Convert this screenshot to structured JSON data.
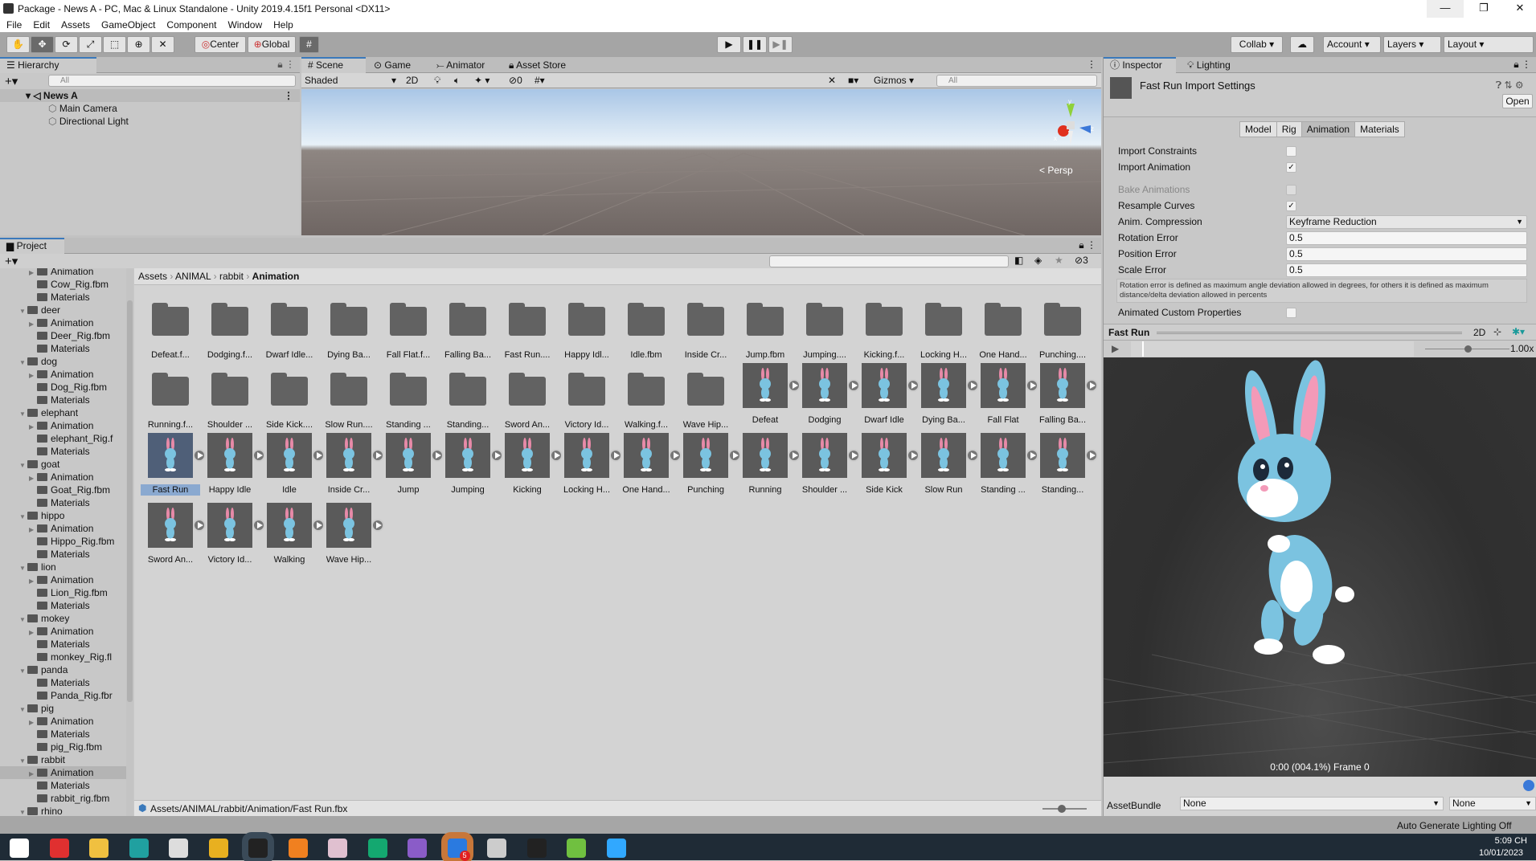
{
  "window": {
    "title": "Package - News A - PC, Mac & Linux Standalone - Unity 2019.4.15f1 Personal <DX11>",
    "minimize": "—",
    "restore": "❐",
    "close": "✕"
  },
  "menu": [
    "File",
    "Edit",
    "Assets",
    "GameObject",
    "Component",
    "Window",
    "Help"
  ],
  "toolbar": {
    "tools": [
      "hand-tool",
      "move-tool",
      "rotate-tool",
      "scale-tool",
      "rect-tool",
      "transform-tool",
      "custom-tool"
    ],
    "center": "Center",
    "global": "Global",
    "collab": "Collab ▾",
    "account": "Account",
    "layers": "Layers",
    "layout": "Layout"
  },
  "hierarchy": {
    "tab": "Hierarchy",
    "search_placeholder": "All",
    "scene": "News A",
    "items": [
      "Main Camera",
      "Directional Light"
    ]
  },
  "scene": {
    "tabs": [
      "Scene",
      "Game",
      "Animator",
      "Asset Store"
    ],
    "shading": "Shaded",
    "mode2d": "2D",
    "hidden_count": "0",
    "gizmos": "Gizmos",
    "search_placeholder": "All",
    "persp": "< Persp",
    "axis_x": "x",
    "axis_y": "y",
    "axis_z": "z"
  },
  "project": {
    "tab": "Project",
    "search_placeholder": "",
    "hidden_count": "3",
    "breadcrumb": [
      "Assets",
      "ANIMAL",
      "rabbit",
      "Animation"
    ],
    "tree": [
      {
        "l": 2,
        "a": 1,
        "t": "Animation"
      },
      {
        "l": 2,
        "t": "Cow_Rig.fbm"
      },
      {
        "l": 2,
        "t": "Materials"
      },
      {
        "l": 1,
        "e": 1,
        "t": "deer"
      },
      {
        "l": 2,
        "a": 1,
        "t": "Animation"
      },
      {
        "l": 2,
        "t": "Deer_Rig.fbm"
      },
      {
        "l": 2,
        "t": "Materials"
      },
      {
        "l": 1,
        "e": 1,
        "t": "dog"
      },
      {
        "l": 2,
        "a": 1,
        "t": "Animation"
      },
      {
        "l": 2,
        "t": "Dog_Rig.fbm"
      },
      {
        "l": 2,
        "t": "Materials"
      },
      {
        "l": 1,
        "e": 1,
        "t": "elephant"
      },
      {
        "l": 2,
        "a": 1,
        "t": "Animation"
      },
      {
        "l": 2,
        "t": "elephant_Rig.f"
      },
      {
        "l": 2,
        "t": "Materials"
      },
      {
        "l": 1,
        "e": 1,
        "t": "goat"
      },
      {
        "l": 2,
        "a": 1,
        "t": "Animation"
      },
      {
        "l": 2,
        "t": "Goat_Rig.fbm"
      },
      {
        "l": 2,
        "t": "Materials"
      },
      {
        "l": 1,
        "e": 1,
        "t": "hippo"
      },
      {
        "l": 2,
        "a": 1,
        "t": "Animation"
      },
      {
        "l": 2,
        "t": "Hippo_Rig.fbm"
      },
      {
        "l": 2,
        "t": "Materials"
      },
      {
        "l": 1,
        "e": 1,
        "t": "lion"
      },
      {
        "l": 2,
        "a": 1,
        "t": "Animation"
      },
      {
        "l": 2,
        "t": "Lion_Rig.fbm"
      },
      {
        "l": 2,
        "t": "Materials"
      },
      {
        "l": 1,
        "e": 1,
        "t": "mokey"
      },
      {
        "l": 2,
        "a": 1,
        "t": "Animation"
      },
      {
        "l": 2,
        "t": "Materials"
      },
      {
        "l": 2,
        "t": "monkey_Rig.fl"
      },
      {
        "l": 1,
        "e": 1,
        "t": "panda"
      },
      {
        "l": 2,
        "t": "Materials"
      },
      {
        "l": 2,
        "t": "Panda_Rig.fbr"
      },
      {
        "l": 1,
        "e": 1,
        "t": "pig"
      },
      {
        "l": 2,
        "a": 1,
        "t": "Animation"
      },
      {
        "l": 2,
        "t": "Materials"
      },
      {
        "l": 2,
        "t": "pig_Rig.fbm"
      },
      {
        "l": 1,
        "e": 1,
        "t": "rabbit"
      },
      {
        "l": 2,
        "a": 1,
        "s": 1,
        "t": "Animation"
      },
      {
        "l": 2,
        "t": "Materials"
      },
      {
        "l": 2,
        "t": "rabbit_rig.fbm"
      },
      {
        "l": 1,
        "e": 1,
        "t": "rhino"
      }
    ],
    "folders": [
      "Defeat.f...",
      "Dodging.f...",
      "Dwarf Idle...",
      "Dying Ba...",
      "Fall Flat.f...",
      "Falling Ba...",
      "Fast Run....",
      "Happy Idl...",
      "Idle.fbm",
      "Inside Cr...",
      "Jump.fbm",
      "Jumping....",
      "Kicking.f...",
      "Locking H...",
      "One Hand...",
      "Punching....",
      "Running.f...",
      "Shoulder ...",
      "Side Kick....",
      "Slow Run....",
      "Standing ...",
      "Standing...",
      "Sword An...",
      "Victory Id...",
      "Walking.f...",
      "Wave Hip..."
    ],
    "animations": [
      "Defeat",
      "Dodging",
      "Dwarf Idle",
      "Dying Ba...",
      "Fall Flat",
      "Falling Ba...",
      "Fast Run",
      "Happy Idle",
      "Idle",
      "Inside Cr...",
      "Jump",
      "Jumping",
      "Kicking",
      "Locking H...",
      "One Hand...",
      "Punching",
      "Running",
      "Shoulder ...",
      "Side Kick",
      "Slow Run",
      "Standing ...",
      "Standing...",
      "Sword An...",
      "Victory Id...",
      "Walking",
      "Wave Hip..."
    ],
    "selected": "Fast Run",
    "footer_path": "Assets/ANIMAL/rabbit/Animation/Fast Run.fbx",
    "icon_size_slider": 0.35
  },
  "inspector": {
    "tabs": [
      "Inspector",
      "Lighting"
    ],
    "asset_title": "Fast Run Import Settings",
    "open": "Open",
    "subtabs": [
      "Model",
      "Rig",
      "Animation",
      "Materials"
    ],
    "active_subtab": "Animation",
    "import_constraints": {
      "label": "Import Constraints",
      "checked": false
    },
    "import_animation": {
      "label": "Import Animation",
      "checked": true
    },
    "bake_animations": {
      "label": "Bake Animations",
      "checked": false
    },
    "resample_curves": {
      "label": "Resample Curves",
      "checked": true
    },
    "anim_compression": {
      "label": "Anim. Compression",
      "value": "Keyframe Reduction"
    },
    "rotation_error": {
      "label": "Rotation Error",
      "value": "0.5"
    },
    "position_error": {
      "label": "Position Error",
      "value": "0.5"
    },
    "scale_error": {
      "label": "Scale Error",
      "value": "0.5"
    },
    "help": "Rotation error is defined as maximum angle deviation allowed in degrees, for others it is defined as maximum distance/delta deviation allowed in percents",
    "animated_custom": {
      "label": "Animated Custom Properties",
      "checked": false
    },
    "preview": {
      "title": "Fast Run",
      "mode2d": "2D",
      "speed": "1.00x",
      "speed_fraction": 0.5,
      "progress_percent": 4.1,
      "status": "0:00 (004.1%) Frame 0"
    },
    "assetbundle": {
      "label": "AssetBundle",
      "value": "None",
      "variant": "None"
    }
  },
  "status": {
    "lighting": "Auto Generate Lighting Off"
  },
  "taskbar": {
    "icons": [
      {
        "n": "windows-start",
        "c": "#ffffff"
      },
      {
        "n": "app-red",
        "c": "#e03030"
      },
      {
        "n": "file-explorer",
        "c": "#f0c040"
      },
      {
        "n": "maya",
        "c": "#20a0a0"
      },
      {
        "n": "zbrush",
        "c": "#dddddd"
      },
      {
        "n": "chrome",
        "c": "#e8b020"
      },
      {
        "n": "unity",
        "c": "#222222"
      },
      {
        "n": "blender",
        "c": "#f08020"
      },
      {
        "n": "app-brain",
        "c": "#e0c0d0"
      },
      {
        "n": "upwork",
        "c": "#14a870"
      },
      {
        "n": "github-desktop",
        "c": "#8a5cc8"
      },
      {
        "n": "zalo",
        "c": "#2a7ae0"
      },
      {
        "n": "unity-hub",
        "c": "#cccccc"
      },
      {
        "n": "unity-2",
        "c": "#222222"
      },
      {
        "n": "app-green",
        "c": "#70c040"
      },
      {
        "n": "photoshop",
        "c": "#31a8ff"
      }
    ],
    "zalo_badge": "5",
    "time": "5:09 CH",
    "date": "10/01/2023"
  }
}
